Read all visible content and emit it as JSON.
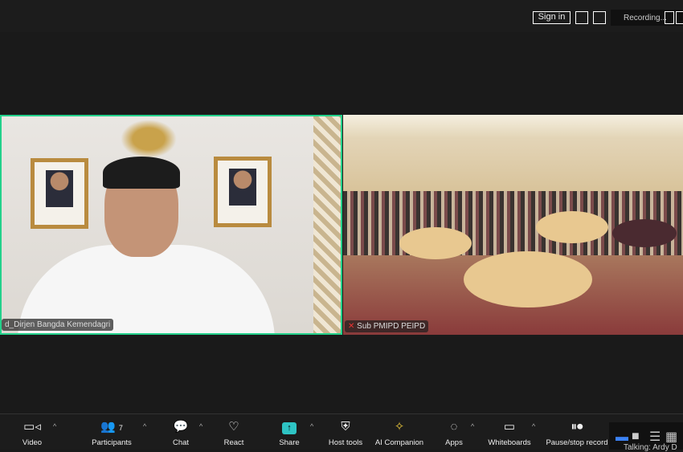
{
  "topbar": {
    "sign_in": "Sign in",
    "recording": "Recording..."
  },
  "tiles": [
    {
      "name": "d_Dirjen Bangda Kemendagri",
      "active_speaker": true,
      "border_color": "#23d18b"
    },
    {
      "name": "Sub PMIPD PEIPD",
      "muted": true
    }
  ],
  "toolbar": {
    "items": [
      {
        "label": "Video",
        "icon": "video-camera-icon"
      },
      {
        "label": "Participants",
        "icon": "participants-icon",
        "count": "7"
      },
      {
        "label": "Chat",
        "icon": "chat-icon"
      },
      {
        "label": "React",
        "icon": "heart-icon"
      },
      {
        "label": "Share",
        "icon": "share-arrow-icon",
        "color": "#2ec4c4"
      },
      {
        "label": "Host tools",
        "icon": "shield-icon"
      },
      {
        "label": "AI Companion",
        "icon": "sparkle-icon",
        "color": "#e8c53a"
      },
      {
        "label": "Apps",
        "icon": "apps-icon"
      },
      {
        "label": "Whiteboards",
        "icon": "whiteboard-icon"
      },
      {
        "label": "Pause/stop record",
        "icon": "pause-stop-icon"
      }
    ]
  },
  "status": {
    "talking": "Talking: Ardy D"
  }
}
